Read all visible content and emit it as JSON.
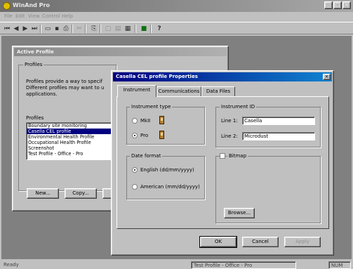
{
  "app": {
    "title": "WinAnd Pro",
    "menu": [
      "File",
      "Edit",
      "View",
      "Control",
      "Help"
    ],
    "status": {
      "left": "Ready",
      "center": "Test Profile - Office - Pro",
      "right": "NUM"
    }
  },
  "active_profile": {
    "title": "Active Profile",
    "group_label": "Profiles",
    "description": "Profiles provide a way to specif Different profiles may want to u applications.",
    "list_label": "Profiles",
    "items": [
      {
        "label": "Boundary site monitoring",
        "selected": false
      },
      {
        "label": "Casella CEL profile",
        "selected": true
      },
      {
        "label": "Environmental Health Profile",
        "selected": false
      },
      {
        "label": "Occupational Health Profile",
        "selected": false
      },
      {
        "label": "Screenshot",
        "selected": false
      },
      {
        "label": "Test Profile - Office - Pro",
        "selected": false
      }
    ],
    "buttons": {
      "new": "New...",
      "copy": "Copy..."
    }
  },
  "dialog": {
    "title": "Casella CEL profile Properties",
    "close": "×",
    "tabs": [
      {
        "label": "Instrument",
        "active": true
      },
      {
        "label": "Communications",
        "active": false
      },
      {
        "label": "Data Files",
        "active": false
      }
    ],
    "instrument_type": {
      "label": "Instrument type",
      "options": [
        {
          "label": "MkII",
          "selected": false
        },
        {
          "label": "Pro",
          "selected": true
        }
      ]
    },
    "date_format": {
      "label": "Date format",
      "options": [
        {
          "label": "English (dd/mm/yyyy)",
          "selected": true
        },
        {
          "label": "American (mm/dd/yyyy)",
          "selected": false
        }
      ]
    },
    "instrument_id": {
      "label": "Instrument ID",
      "line1_label": "Line 1:",
      "line1_value": "Casella",
      "line2_label": "Line 2:",
      "line2_value": "Microdust"
    },
    "bitmap": {
      "label": "Bitmap",
      "checked": false
    },
    "browse": "Browse...",
    "ok": "OK",
    "cancel": "Cancel",
    "apply": "Apply"
  }
}
